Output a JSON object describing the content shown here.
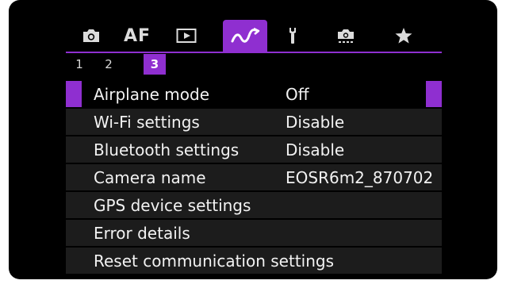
{
  "tabs": [
    {
      "name": "shooting",
      "icon": "camera-icon"
    },
    {
      "name": "af",
      "label": "AF"
    },
    {
      "name": "playback",
      "icon": "play-icon"
    },
    {
      "name": "wireless",
      "icon": "wireless-icon",
      "active": true
    },
    {
      "name": "setup",
      "icon": "wrench-icon"
    },
    {
      "name": "custom-functions",
      "icon": "custom-camera-icon"
    },
    {
      "name": "my-menu",
      "icon": "star-icon"
    }
  ],
  "pages": [
    "1",
    "2",
    "3"
  ],
  "active_page": "3",
  "menu": [
    {
      "label": "Airplane mode",
      "value": "Off",
      "selected": true
    },
    {
      "label": "Wi-Fi settings",
      "value": "Disable"
    },
    {
      "label": "Bluetooth settings",
      "value": "Disable"
    },
    {
      "label": "Camera name",
      "value": "EOSR6m2_870702"
    },
    {
      "label": "GPS device settings",
      "value": ""
    },
    {
      "label": "Error details",
      "value": ""
    },
    {
      "label": "Reset communication settings",
      "value": ""
    }
  ],
  "colors": {
    "accent": "#8f2fd0",
    "background": "#000000",
    "row": "#1c1c1c",
    "text": "#f2f2f2"
  }
}
